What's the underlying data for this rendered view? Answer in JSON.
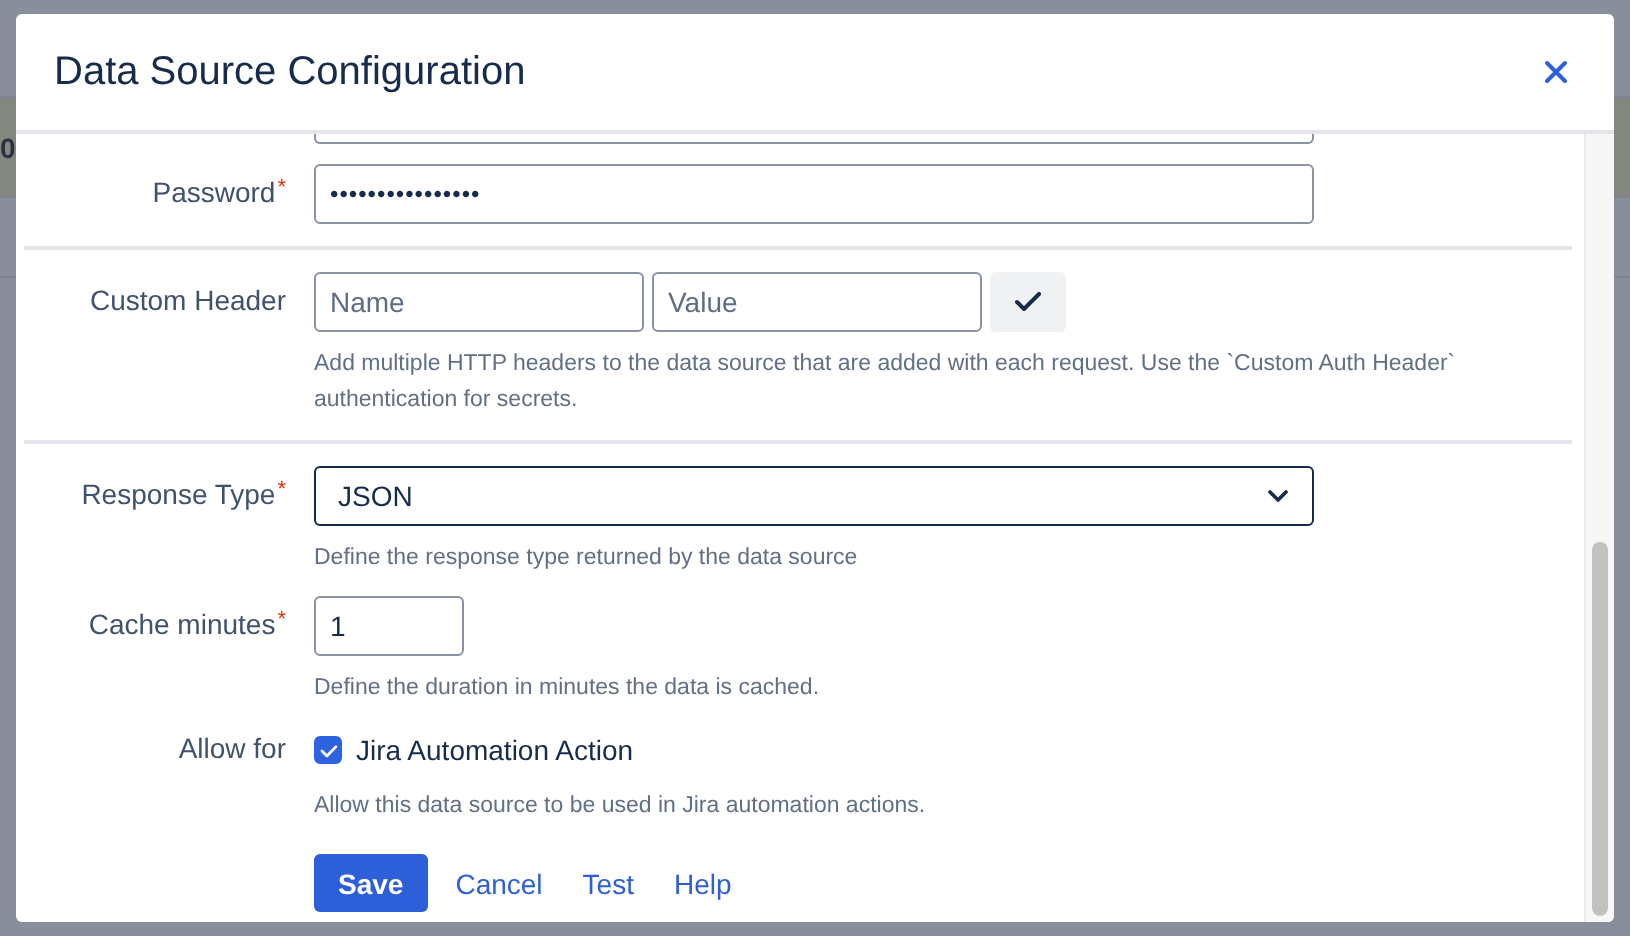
{
  "background_table": {
    "rows": [
      {
        "cells": [
          "0"
        ]
      },
      {
        "cells": []
      },
      {
        "cells": []
      }
    ]
  },
  "dialog": {
    "title": "Data Source Configuration",
    "sections": [
      {
        "fields": [
          {
            "kind": "clipped"
          },
          {
            "kind": "password",
            "label": "Password",
            "required_mark": "*",
            "value": "••••••••••••••••"
          }
        ]
      },
      {
        "fields": [
          {
            "kind": "pair",
            "label": "Custom Header",
            "placeholders": [
              "Name",
              "Value"
            ],
            "help": "Add multiple HTTP headers to the data source that are added with each request. Use the `Custom Auth Header` authentication for secrets."
          }
        ]
      },
      {
        "fields": [
          {
            "kind": "select",
            "label": "Response Type",
            "required_mark": "*",
            "value": "JSON",
            "help": "Define the response type returned by the data source"
          },
          {
            "kind": "number",
            "label": "Cache minutes",
            "required_mark": "*",
            "value": "1",
            "help": "Define the duration in minutes the data is cached."
          },
          {
            "kind": "checkbox",
            "label": "Allow for",
            "option": "Jira Automation Action",
            "checked": true,
            "help": "Allow this data source to be used in Jira automation actions."
          }
        ]
      }
    ],
    "buttons": [
      {
        "label": "Save",
        "kind": "primary"
      },
      {
        "label": "Cancel",
        "kind": "link"
      },
      {
        "label": "Test",
        "kind": "link"
      },
      {
        "label": "Help",
        "kind": "link"
      }
    ]
  }
}
